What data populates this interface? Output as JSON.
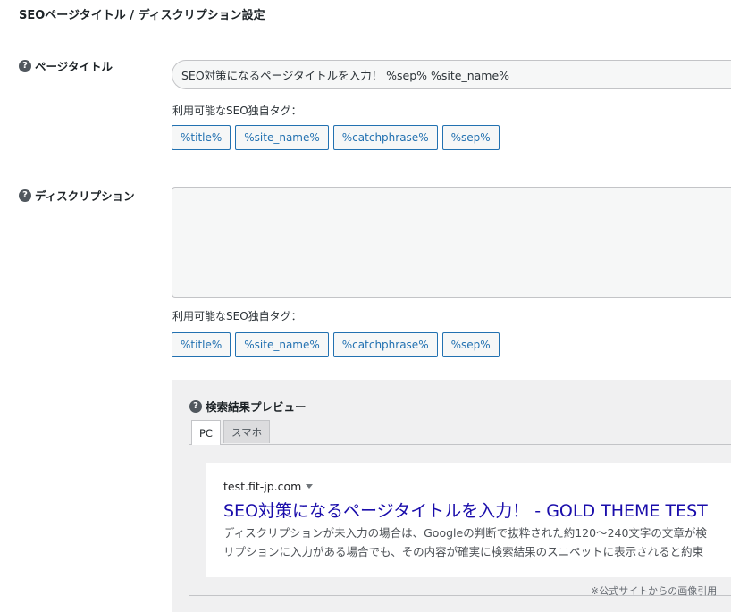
{
  "page": {
    "heading": "SEOページタイトル / ディスクリプション設定"
  },
  "title_row": {
    "label": "ページタイトル",
    "input_value": "SEO対策になるページタイトルを入力！ %sep% %site_name%",
    "tags_label": "利用可能なSEO独自タグ：",
    "tags": [
      "%title%",
      "%site_name%",
      "%catchphrase%",
      "%sep%"
    ]
  },
  "description_row": {
    "label": "ディスクリプション",
    "textarea_value": "",
    "tags_label": "利用可能なSEO独自タグ：",
    "tags": [
      "%title%",
      "%site_name%",
      "%catchphrase%",
      "%sep%"
    ]
  },
  "preview": {
    "title": "検索結果プレビュー",
    "tabs": [
      {
        "label": "PC",
        "active": true
      },
      {
        "label": "スマホ",
        "active": false
      }
    ],
    "serp": {
      "url": "test.fit-jp.com",
      "title": "SEO対策になるページタイトルを入力！ - GOLD THEME TEST",
      "desc_line1": "ディスクリプションが未入力の場合は、Googleの判断で抜粋された約120〜240文字の文章が検",
      "desc_line2": "リプションに入力がある場合でも、その内容が確実に検索結果のスニペットに表示されると約束"
    },
    "footnote": "※公式サイトからの画像引用"
  },
  "icons": {
    "help": "question-circle-icon",
    "dropdown": "caret-down-icon"
  },
  "colors": {
    "link_blue": "#1a0dab",
    "tag_blue": "#2271b1",
    "panel_gray": "#f0f0f1"
  }
}
